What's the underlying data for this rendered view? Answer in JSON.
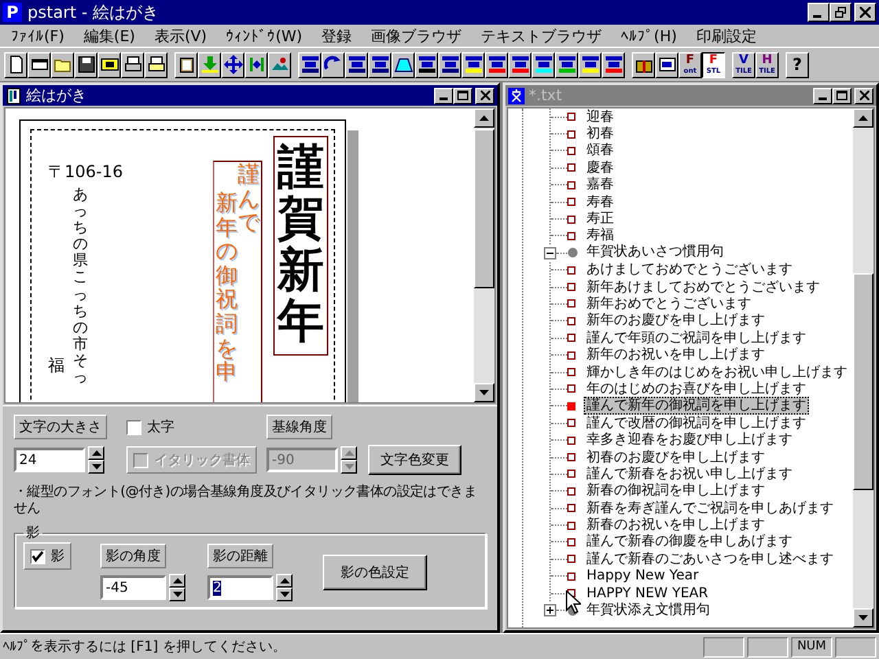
{
  "window": {
    "icon_letter": "P",
    "title": "pstart - 絵はがき"
  },
  "menu": [
    "ﾌｧｲﾙ(F)",
    "編集(E)",
    "表示(V)",
    "ｳｨﾝﾄﾞｳ(W)",
    "登録",
    "画像ブラウザ",
    "テキストブラウザ",
    "ﾍﾙﾌﾟ(H)",
    "印刷設定"
  ],
  "toolbar": {
    "text_buttons": [
      {
        "top": "F",
        "bottom": "ont",
        "color": "#800000",
        "pressed": false
      },
      {
        "top": "F",
        "bottom": "STL",
        "color": "#ff0000",
        "pressed": true
      },
      {
        "top": "V",
        "bottom": "TILE",
        "color": "#0000c0",
        "pressed": false
      },
      {
        "top": "H",
        "bottom": "TILE",
        "color": "#800080",
        "pressed": false
      }
    ],
    "help": "?"
  },
  "postcard_window": {
    "title": "絵はがき",
    "active": true,
    "postcard": {
      "postal_code": "〒106-16",
      "address": "あっちの県こっちの市そっ",
      "name": "福",
      "greeting_lines": [
        "謹んで",
        "新年の御祝詞を申"
      ],
      "headline": "謹賀新年"
    },
    "settings": {
      "size_label": "文字の大きさ",
      "size": {
        "value": "24",
        "disabled": false
      },
      "bold": {
        "label": "太字",
        "checked": false,
        "disabled": false
      },
      "angle_label": "基線角度",
      "angle": {
        "value": "-90",
        "disabled": true
      },
      "italic": {
        "label": "イタリック書体",
        "checked": false,
        "disabled": true
      },
      "color_button": "文字色変更",
      "note": "・縦型のフォント(@付き)の場合基線角度及びイタリック書体の設定はできません",
      "shadow": {
        "title": "影",
        "checkbox": {
          "label": "影",
          "checked": true,
          "disabled": false
        },
        "angle_label": "影の角度",
        "distance_label": "影の距離",
        "angle": {
          "value": "-45",
          "disabled": false,
          "text_selected": false
        },
        "distance": {
          "value": "2",
          "disabled": false,
          "text_selected": true
        },
        "color_button": "影の色設定"
      }
    }
  },
  "text_window": {
    "title": "*.txt",
    "active": false,
    "tree": [
      {
        "children": [
          {
            "label": "迎春",
            "selected": false
          },
          {
            "label": "初春",
            "selected": false
          },
          {
            "label": "頌春",
            "selected": false
          },
          {
            "label": "慶春",
            "selected": false
          },
          {
            "label": "嘉春",
            "selected": false
          },
          {
            "label": "寿春",
            "selected": false
          },
          {
            "label": "寿正",
            "selected": false
          },
          {
            "label": "寿福",
            "selected": false
          }
        ]
      },
      {
        "label": "年賀状あいさつ慣用句",
        "expanded": true,
        "children": [
          {
            "label": "あけましておめでとうございます",
            "selected": false
          },
          {
            "label": "新年あけましておめでとうございます",
            "selected": false
          },
          {
            "label": "新年おめでとうございます",
            "selected": false
          },
          {
            "label": "新年のお慶びを申し上げます",
            "selected": false
          },
          {
            "label": "謹んで年頭のご祝詞を申し上げます",
            "selected": false
          },
          {
            "label": "新年のお祝いを申し上げます",
            "selected": false
          },
          {
            "label": "輝かしき年のはじめをお祝い申し上げます",
            "selected": false
          },
          {
            "label": "年のはじめのお喜びを申し上げます",
            "selected": false
          },
          {
            "label": "謹んで新年の御祝詞を申し上げます",
            "selected": true
          },
          {
            "label": "謹んで改暦の御祝詞を申し上げます",
            "selected": false
          },
          {
            "label": "幸多き迎春をお慶び申し上げます",
            "selected": false
          },
          {
            "label": "初春のお慶びを申し上げます",
            "selected": false
          },
          {
            "label": "謹んで新春をお祝い申し上げます",
            "selected": false
          },
          {
            "label": "新春の御祝詞を申し上げます",
            "selected": false
          },
          {
            "label": "新春を寿ぎ謹んでご祝詞を申しあげます",
            "selected": false
          },
          {
            "label": "新春のお祝いを申し上げます",
            "selected": false
          },
          {
            "label": "謹んで新春の御慶を申しあげます",
            "selected": false
          },
          {
            "label": "謹んで新春のごあいさつを申し述べます",
            "selected": false
          },
          {
            "label": "Happy New Year",
            "selected": false
          },
          {
            "label": "HAPPY NEW YEAR",
            "selected": false
          }
        ]
      },
      {
        "label": "年賀状添え文慣用句",
        "expanded": false
      }
    ]
  },
  "status_bar": {
    "message": "ﾍﾙﾌﾟを表示するには [F1] を押してください。",
    "indicators": [
      {
        "label": "NUM"
      }
    ]
  }
}
